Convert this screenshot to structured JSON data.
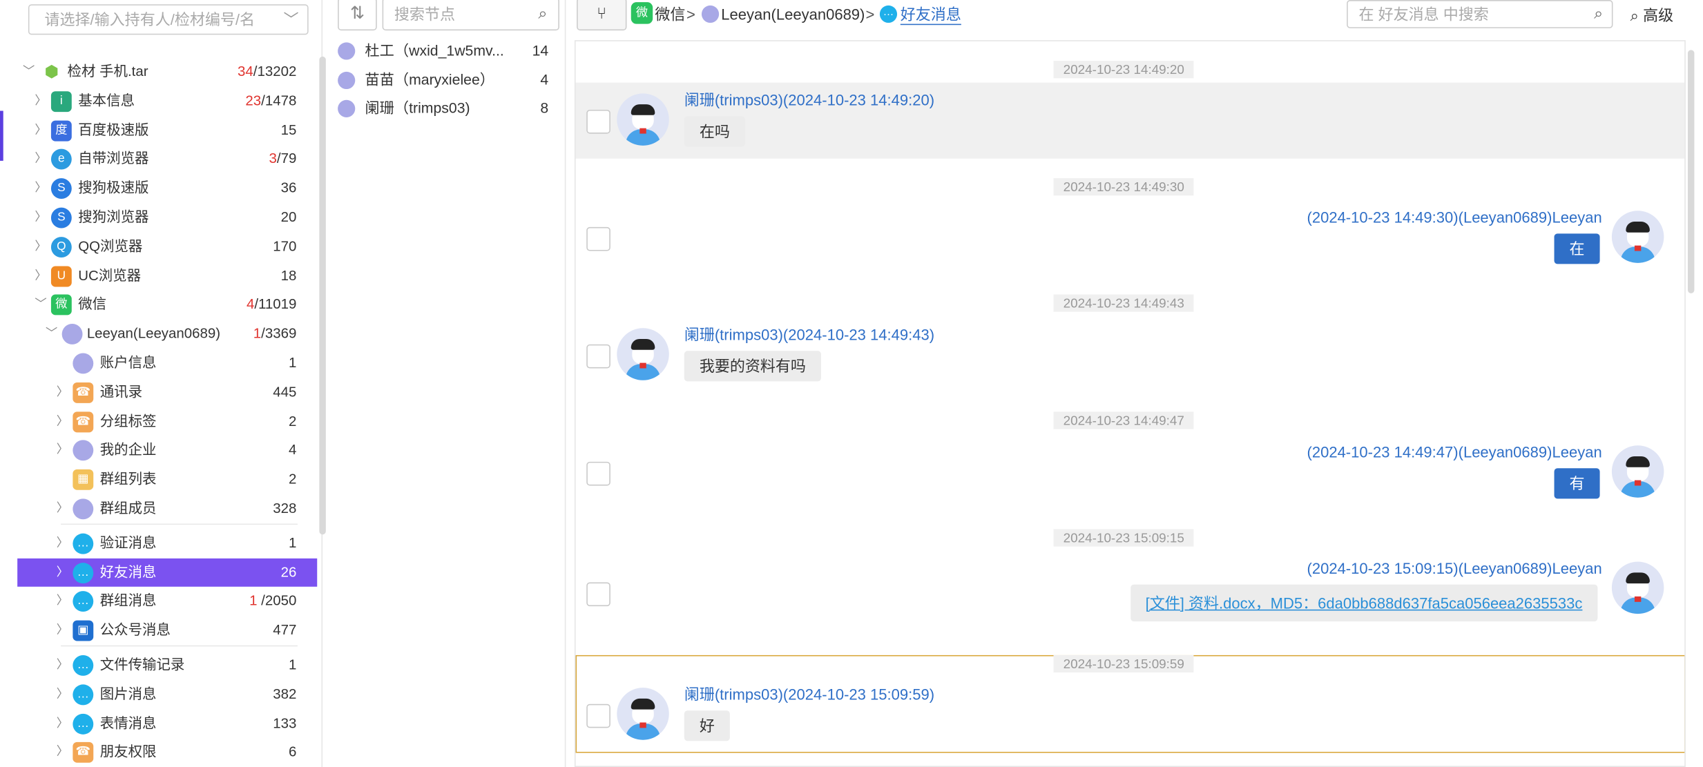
{
  "left_panel": {
    "selector_placeholder": "请选择/输入持有人/检材编号/名",
    "tree": [
      {
        "key": "root",
        "label": "检材 手机.tar",
        "count_red": "34",
        "count": "/13202"
      },
      {
        "key": "basic",
        "label": "基本信息",
        "count_red": "23",
        "count": "/1478"
      },
      {
        "key": "baidu",
        "label": "百度极速版",
        "count": "15"
      },
      {
        "key": "builtin",
        "label": "自带浏览器",
        "count_red": "3",
        "count": "/79"
      },
      {
        "key": "sogou_fast",
        "label": "搜狗极速版",
        "count": "36"
      },
      {
        "key": "sogou",
        "label": "搜狗浏览器",
        "count": "20"
      },
      {
        "key": "qq",
        "label": "QQ浏览器",
        "count": "170"
      },
      {
        "key": "uc",
        "label": "UC浏览器",
        "count": "18"
      },
      {
        "key": "wechat",
        "label": "微信",
        "count_red": "4",
        "count": "/11019"
      },
      {
        "key": "account",
        "label": "Leeyan(Leeyan0689)",
        "count_red": "1",
        "count": "/3369"
      },
      {
        "key": "acctinfo",
        "label": "账户信息",
        "count": "1"
      },
      {
        "key": "contacts",
        "label": "通讯录",
        "count": "445"
      },
      {
        "key": "groups",
        "label": "分组标签",
        "count": "2"
      },
      {
        "key": "company",
        "label": "我的企业",
        "count": "4"
      },
      {
        "key": "grouplist",
        "label": "群组列表",
        "count": "2"
      },
      {
        "key": "groupmembers",
        "label": "群组成员",
        "count": "328"
      },
      {
        "key": "verify",
        "label": "验证消息",
        "count": "1"
      },
      {
        "key": "friendmsg",
        "label": "好友消息",
        "count": "26"
      },
      {
        "key": "groupmsg",
        "label": "群组消息",
        "count_red": "1",
        "count": "/2050"
      },
      {
        "key": "official",
        "label": "公众号消息",
        "count": "477"
      },
      {
        "key": "filetransfer",
        "label": "文件传输记录",
        "count": "1"
      },
      {
        "key": "images",
        "label": "图片消息",
        "count": "382"
      },
      {
        "key": "emoji",
        "label": "表情消息",
        "count": "133"
      },
      {
        "key": "moments",
        "label": "朋友权限",
        "count": "6"
      }
    ]
  },
  "middle_panel": {
    "search_placeholder": "搜索节点",
    "contacts": [
      {
        "name": "杜工（wxid_1w5mv...",
        "count": "14"
      },
      {
        "name": "苗苗（maryxielee）",
        "count": "4"
      },
      {
        "name": "阑珊（trimps03)",
        "count": "8"
      }
    ]
  },
  "breadcrumb": {
    "app": "微信",
    "account": "Leeyan(Leeyan0689)",
    "current": "好友消息",
    "sep": ">"
  },
  "top_search": {
    "placeholder": "在 好友消息 中搜索"
  },
  "advanced_label": "高级",
  "chat": {
    "messages": [
      {
        "time": "2024-10-23 14:49:20",
        "sender": "阑珊(trimps03)(2024-10-23 14:49:20)",
        "text": "在吗",
        "dir": "in"
      },
      {
        "time": "2024-10-23 14:49:30",
        "sender": "(2024-10-23 14:49:30)(Leeyan0689)Leeyan",
        "text": "在",
        "dir": "out"
      },
      {
        "time": "2024-10-23 14:49:43",
        "sender": "阑珊(trimps03)(2024-10-23 14:49:43)",
        "text": "我要的资料有吗",
        "dir": "in"
      },
      {
        "time": "2024-10-23 14:49:47",
        "sender": "(2024-10-23 14:49:47)(Leeyan0689)Leeyan",
        "text": "有",
        "dir": "out"
      },
      {
        "time": "2024-10-23 15:09:15",
        "sender": "(2024-10-23 15:09:15)(Leeyan0689)Leeyan",
        "text": "[文件] 资料.docx，MD5：6da0bb688d637fa5ca056eea2635533c",
        "dir": "out-file"
      },
      {
        "time": "2024-10-23 15:09:59",
        "sender": "阑珊(trimps03)(2024-10-23 15:09:59)",
        "text": "好",
        "dir": "in"
      }
    ]
  },
  "colors": {
    "accent": "#7b52f0",
    "link": "#2f6fc7",
    "red": "#e0342f",
    "out_bubble": "#2f6fc7",
    "selected_border": "#d9a83c"
  }
}
